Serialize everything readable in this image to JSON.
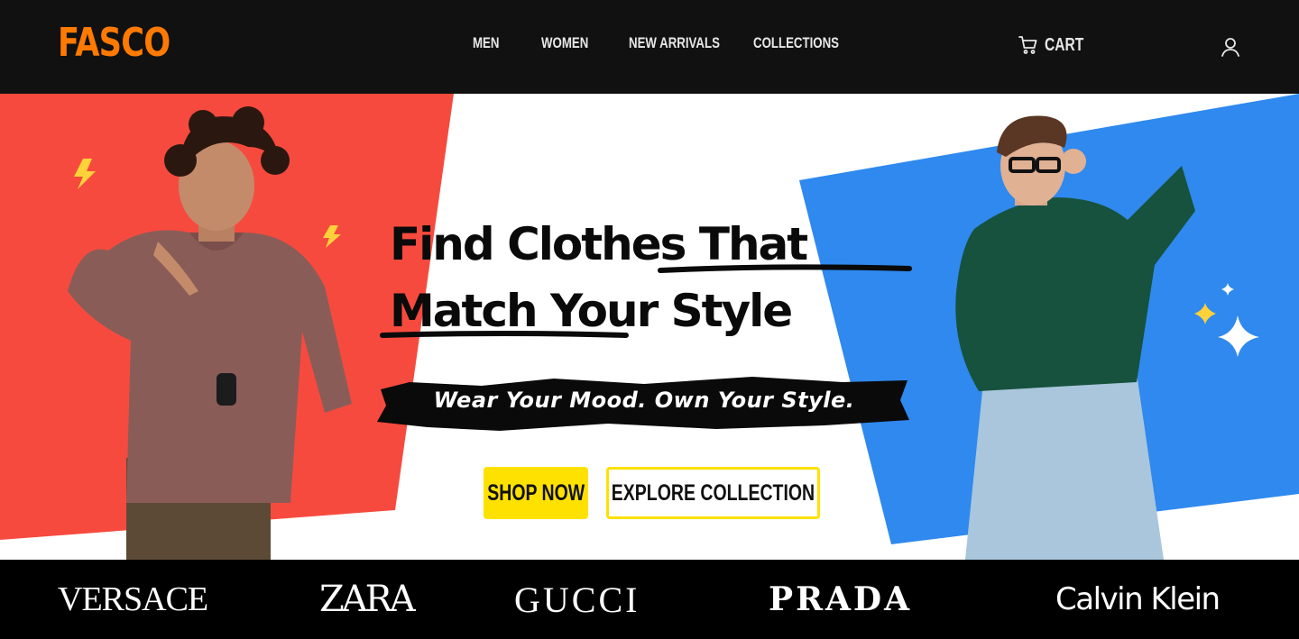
{
  "brand": {
    "logo": "FASCO",
    "accent": "#ff7a00"
  },
  "nav": {
    "items": [
      "MEN",
      "WOMEN",
      "NEW ARRIVALS",
      "COLLECTIONS"
    ]
  },
  "header": {
    "cart_label": "CART",
    "cart_icon": "cart-icon",
    "user_icon": "user-icon"
  },
  "hero": {
    "headline_line1": "Find Clothes That",
    "headline_line2": "Match Your Style",
    "tagline": "Wear Your Mood. Own Your Style.",
    "shop_now": "SHOP NOW",
    "explore": "EXPLORE COLLECTION",
    "colors": {
      "red": "#f74a3e",
      "blue": "#2f89ee",
      "yellow": "#ffe100"
    }
  },
  "brands": [
    "VERSACE",
    "ZARA",
    "GUCCI",
    "PRADA",
    "Calvin Klein"
  ]
}
